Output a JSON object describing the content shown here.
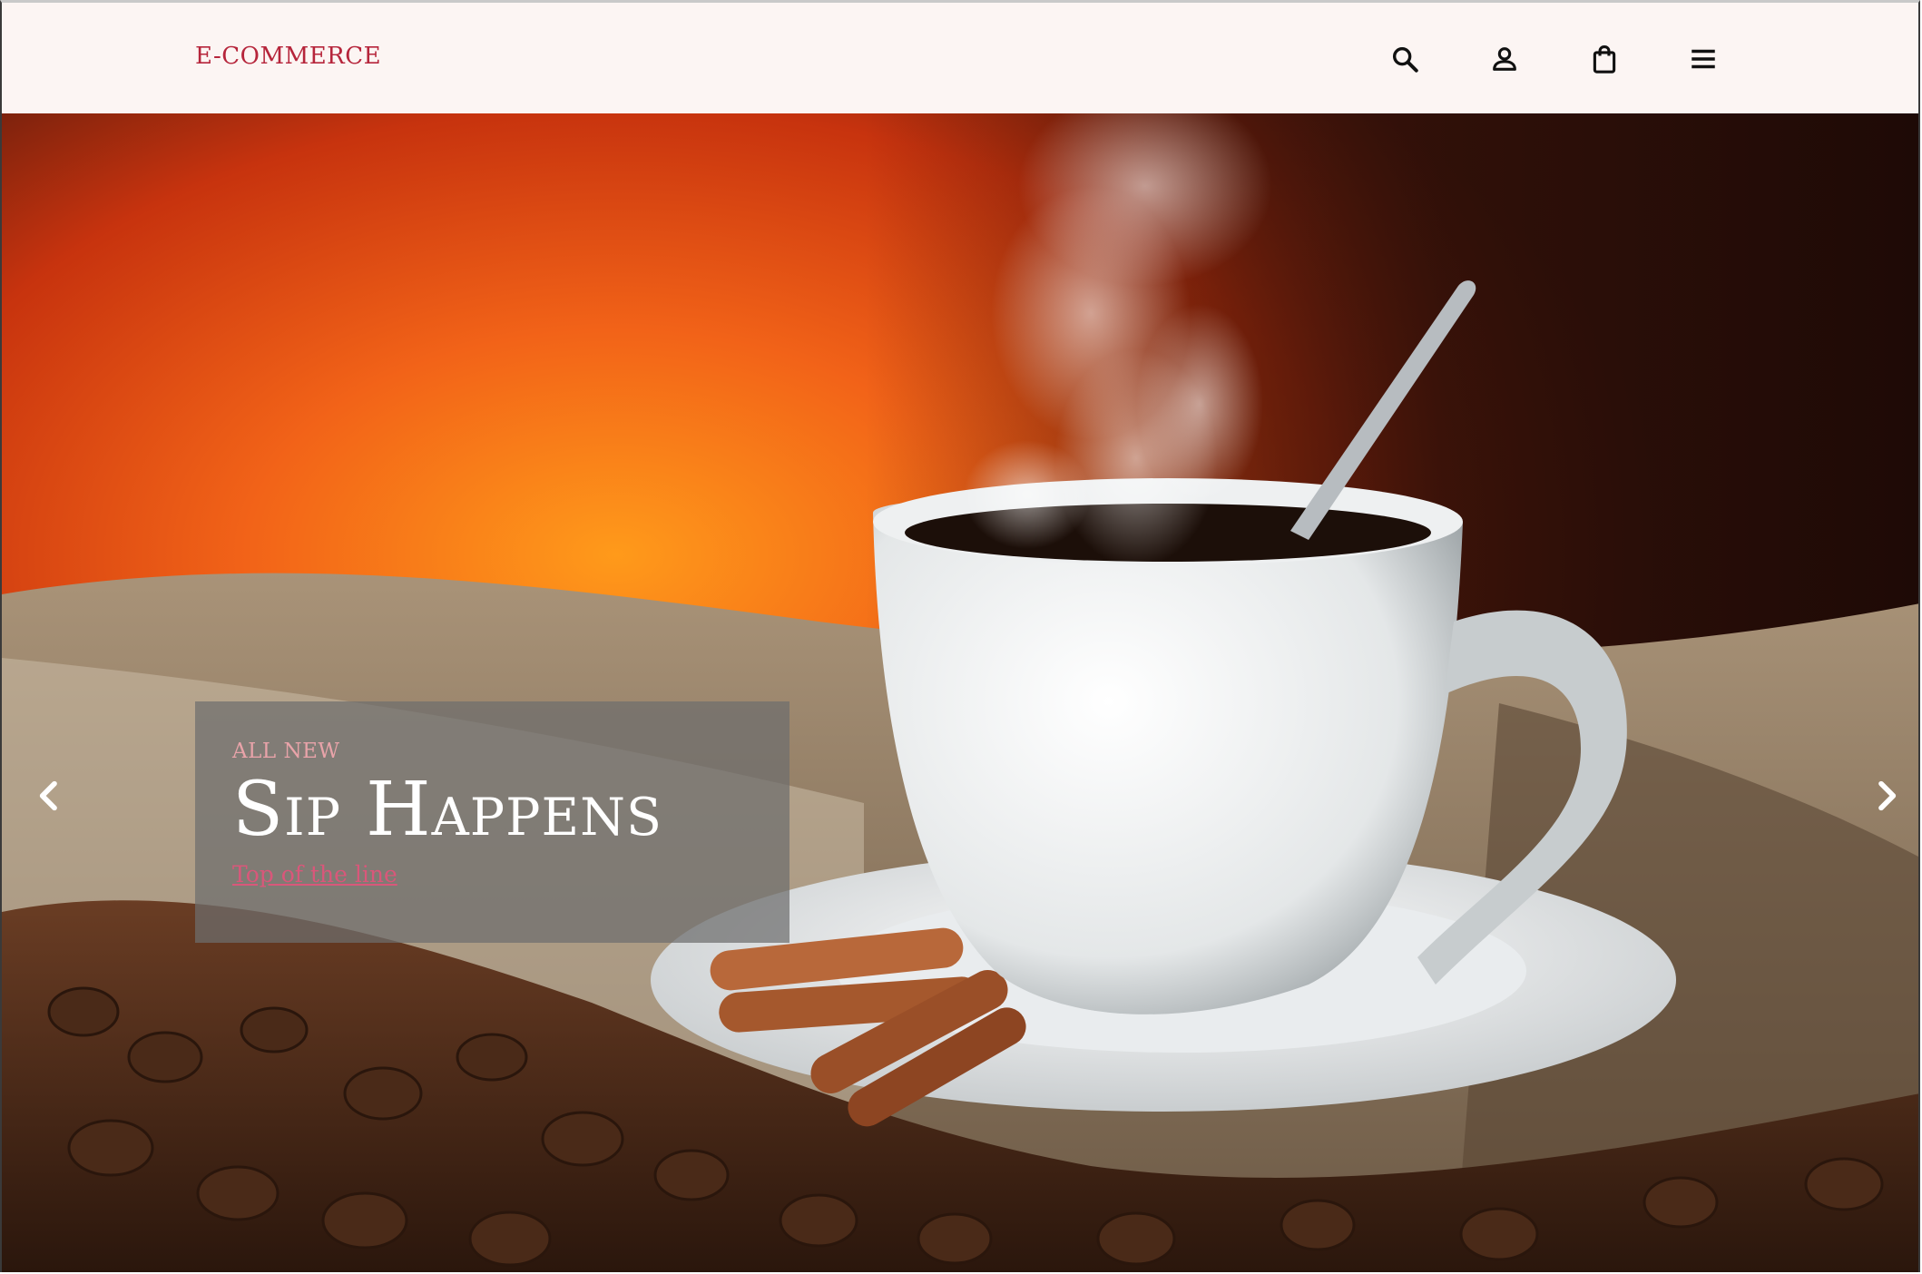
{
  "header": {
    "brand": "E-COMMERCE",
    "icons": [
      "search-icon",
      "account-icon",
      "shopping-bag-icon",
      "menu-icon"
    ]
  },
  "hero": {
    "image": "steaming-coffee-cup-on-saucer-with-cinnamon-and-beans",
    "caption": {
      "eyebrow": "ALL NEW",
      "headline": "Sip Happens",
      "link": "Top of the line"
    },
    "prev_icon": "chevron-left-icon",
    "next_icon": "chevron-right-icon"
  },
  "colors": {
    "brand": "#b6253b",
    "header_bg": "#fcf5f3",
    "caption_bg": "#6e6e6e",
    "eyebrow": "#e8a3a9",
    "link": "#d9577a"
  }
}
